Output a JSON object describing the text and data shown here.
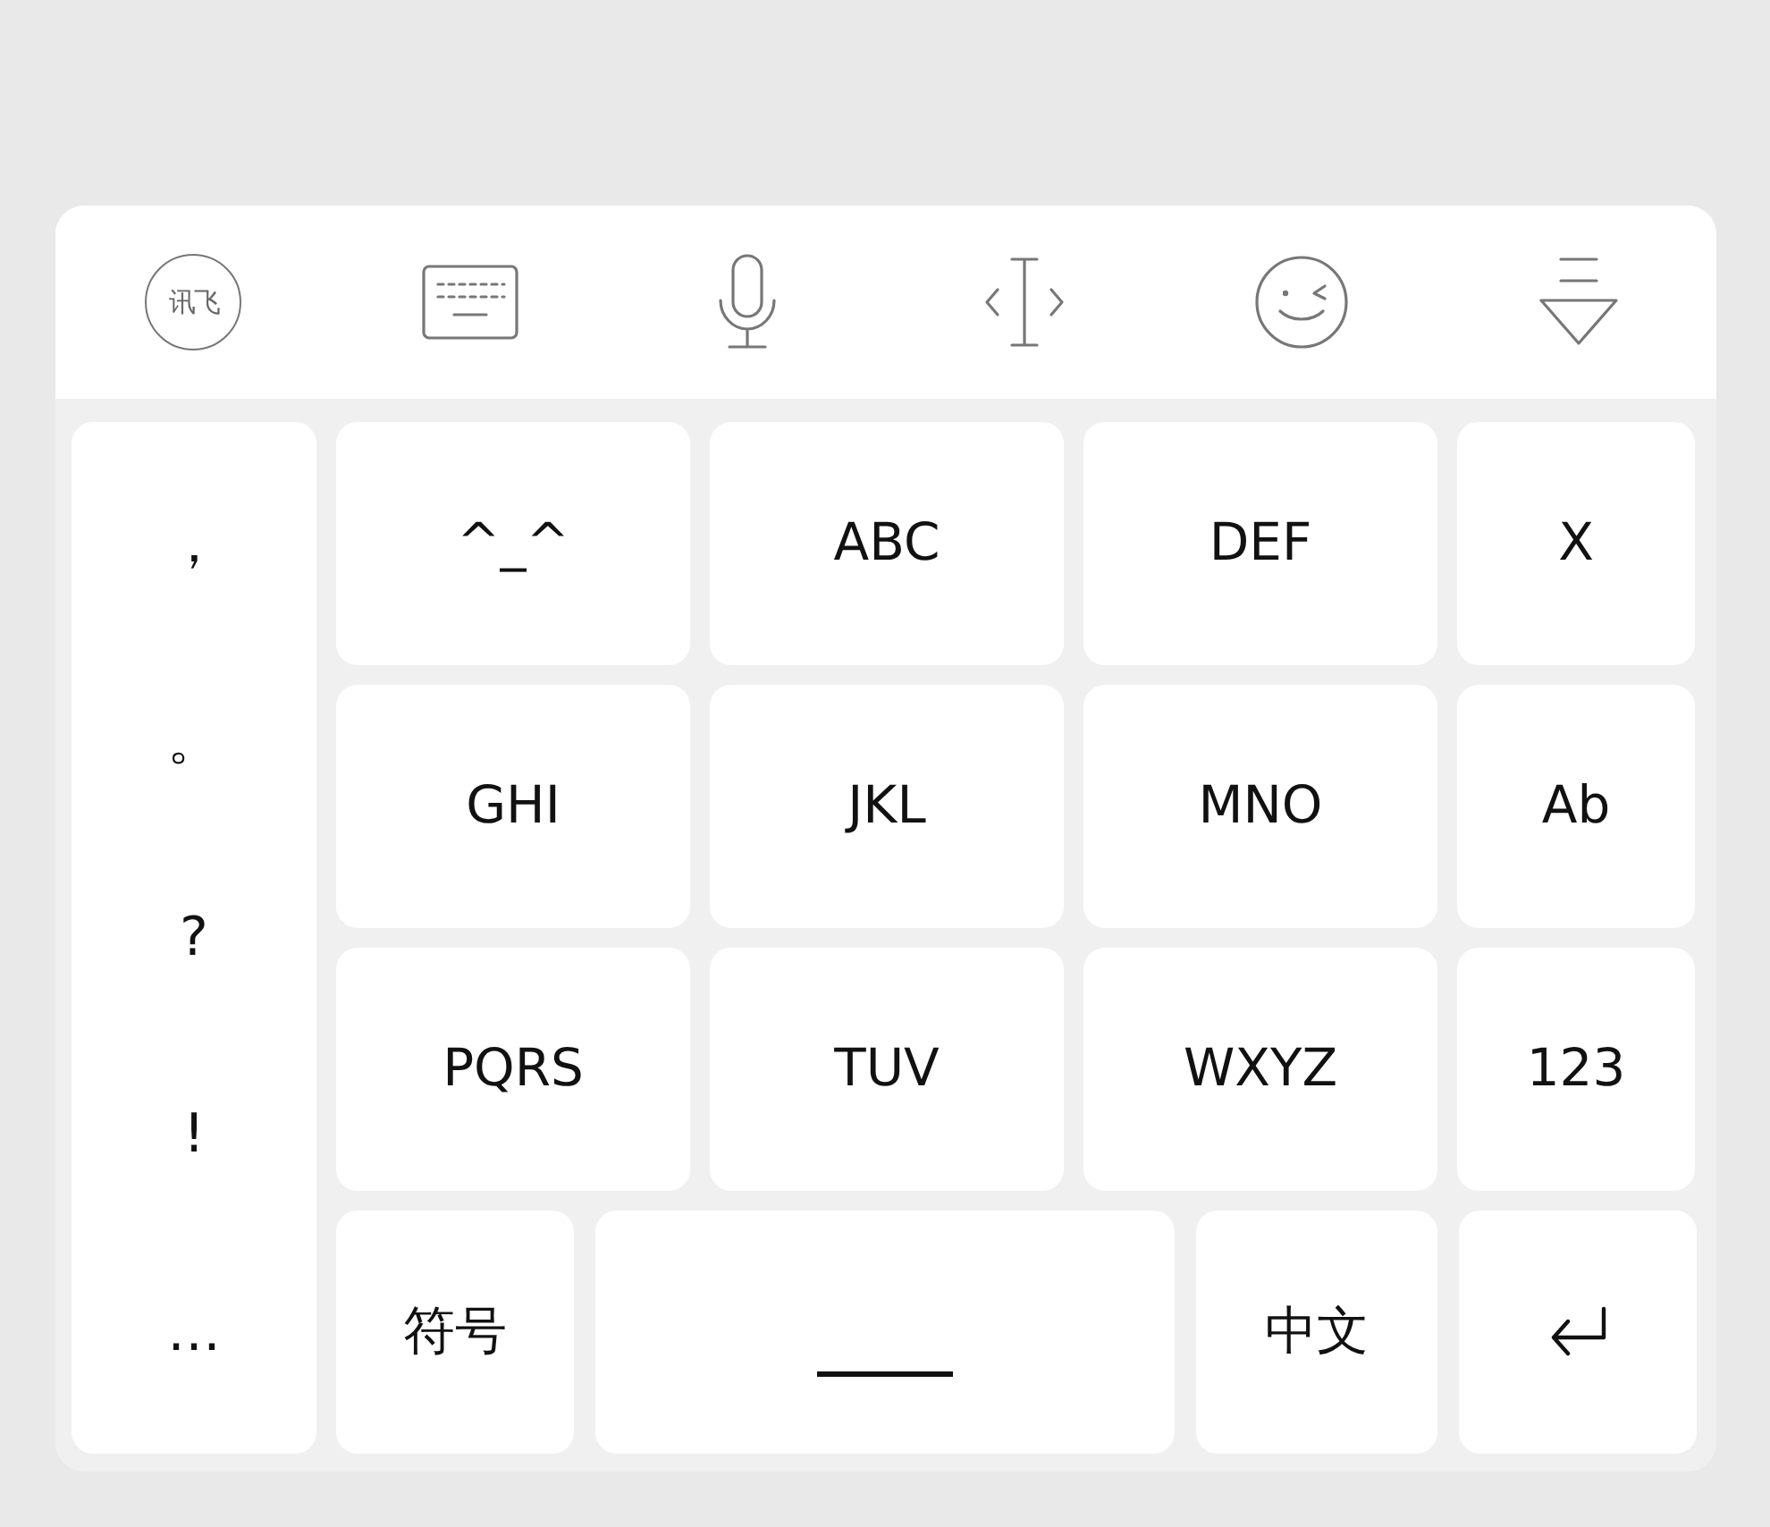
{
  "toolbar": {
    "logo_text": "讯飞"
  },
  "punctuation_keys": [
    "，",
    "。",
    "?",
    "!",
    "…"
  ],
  "key_rows": [
    [
      {
        "kind": "text",
        "label": "^_^"
      },
      {
        "kind": "text",
        "label": "ABC"
      },
      {
        "kind": "text",
        "label": "DEF"
      },
      {
        "kind": "text",
        "label": "X"
      }
    ],
    [
      {
        "kind": "text",
        "label": "GHI"
      },
      {
        "kind": "text",
        "label": "JKL"
      },
      {
        "kind": "text",
        "label": "MNO"
      },
      {
        "kind": "text",
        "label": "Ab"
      }
    ],
    [
      {
        "kind": "text",
        "label": "PQRS"
      },
      {
        "kind": "text",
        "label": "TUV"
      },
      {
        "kind": "text",
        "label": "WXYZ"
      },
      {
        "kind": "text",
        "label": "123"
      }
    ]
  ],
  "bottom_row": [
    {
      "kind": "text",
      "label": "符号"
    },
    {
      "kind": "space"
    },
    {
      "kind": "text",
      "label": "中文"
    },
    {
      "kind": "enter"
    }
  ]
}
